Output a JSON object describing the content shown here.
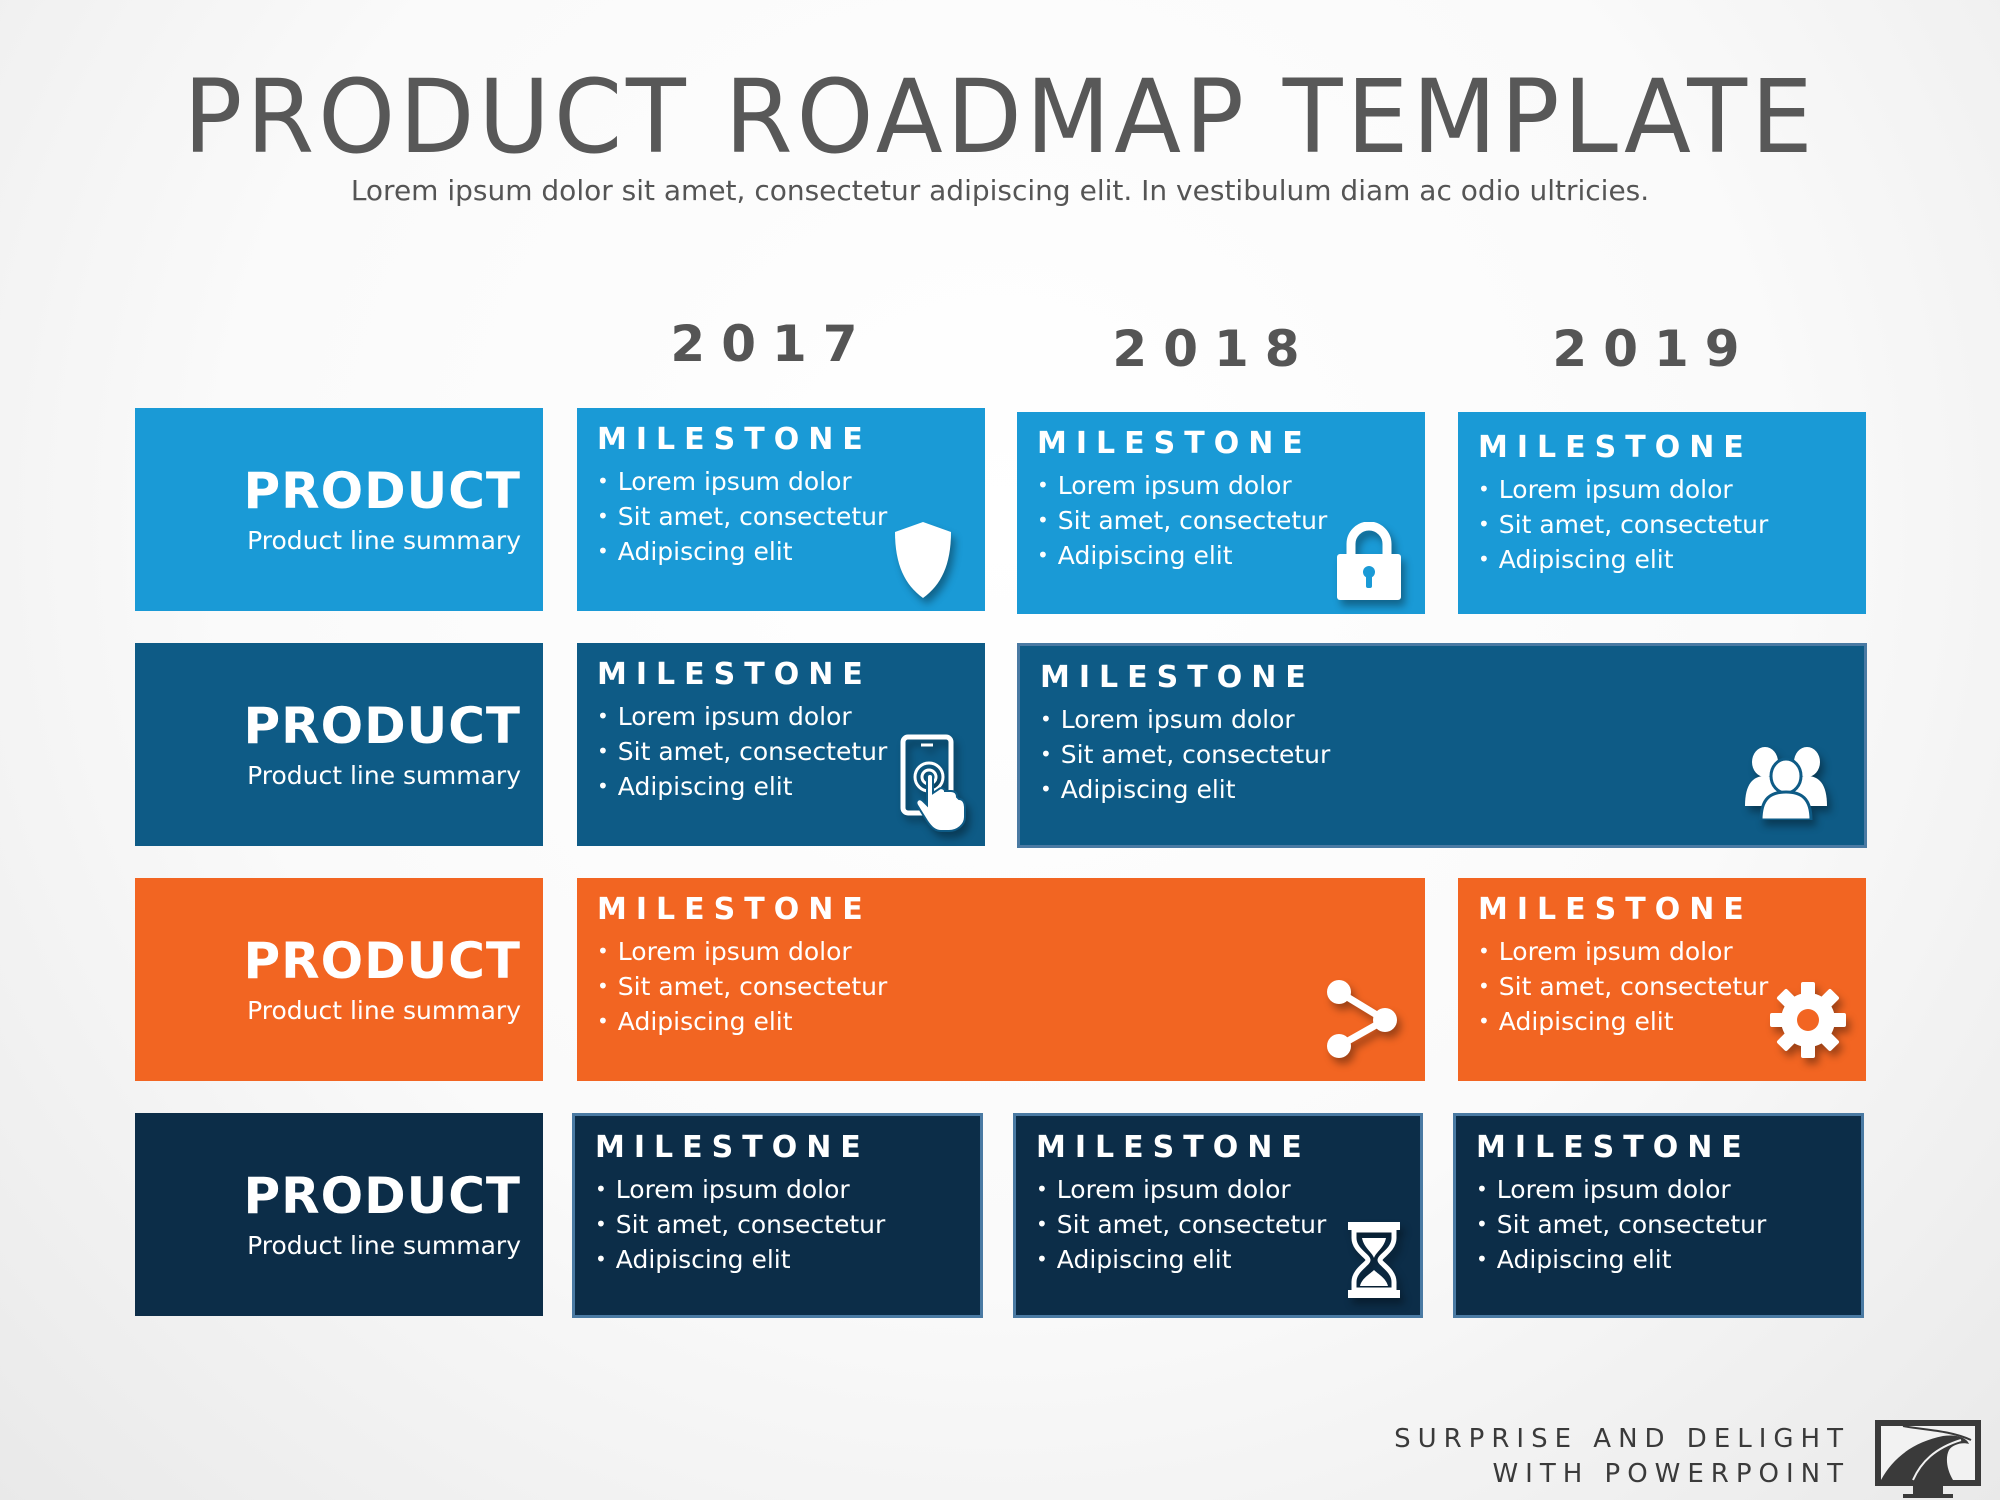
{
  "header": {
    "title": "PRODUCT ROADMAP TEMPLATE",
    "subtitle": "Lorem ipsum dolor sit amet, consectetur adipiscing elit. In vestibulum diam ac odio ultricies."
  },
  "years": [
    "2017",
    "2018",
    "2019"
  ],
  "colors": {
    "light_blue": "#1a9ad6",
    "medium_blue": "#0e5b86",
    "orange": "#f26522",
    "dark_navy": "#0c2d48",
    "text_gray": "#585858"
  },
  "rows": [
    {
      "product": "PRODUCT",
      "summary": "Product line summary",
      "milestones": [
        {
          "title": "MILESTONE",
          "span": "2017",
          "bullets": [
            "Lorem ipsum dolor",
            "Sit amet, consectetur",
            "Adipiscing elit"
          ],
          "icon": "shield-icon"
        },
        {
          "title": "MILESTONE",
          "span": "2018",
          "bullets": [
            "Lorem ipsum dolor",
            "Sit amet, consectetur",
            "Adipiscing elit"
          ],
          "icon": "lock-icon"
        },
        {
          "title": "MILESTONE",
          "span": "2019",
          "bullets": [
            "Lorem ipsum dolor",
            "Sit amet, consectetur",
            "Adipiscing elit"
          ],
          "icon": ""
        }
      ]
    },
    {
      "product": "PRODUCT",
      "summary": "Product line summary",
      "milestones": [
        {
          "title": "MILESTONE",
          "span": "2017",
          "bullets": [
            "Lorem ipsum dolor",
            "Sit amet, consectetur",
            "Adipiscing elit"
          ],
          "icon": "touch-phone-icon"
        },
        {
          "title": "MILESTONE",
          "span": "2018-2019",
          "bullets": [
            "Lorem ipsum dolor",
            "Sit amet, consectetur",
            "Adipiscing elit"
          ],
          "icon": "users-icon"
        }
      ]
    },
    {
      "product": "PRODUCT",
      "summary": "Product line summary",
      "milestones": [
        {
          "title": "MILESTONE",
          "span": "2017-2018",
          "bullets": [
            "Lorem ipsum dolor",
            "Sit amet, consectetur",
            "Adipiscing elit"
          ],
          "icon": "share-icon"
        },
        {
          "title": "MILESTONE",
          "span": "2019",
          "bullets": [
            "Lorem ipsum dolor",
            "Sit amet, consectetur",
            "Adipiscing elit"
          ],
          "icon": "gear-icon"
        }
      ]
    },
    {
      "product": "PRODUCT",
      "summary": "Product line summary",
      "milestones": [
        {
          "title": "MILESTONE",
          "span": "2017",
          "bullets": [
            "Lorem ipsum dolor",
            "Sit amet, consectetur",
            "Adipiscing elit"
          ],
          "icon": ""
        },
        {
          "title": "MILESTONE",
          "span": "2018",
          "bullets": [
            "Lorem ipsum dolor",
            "Sit amet, consectetur",
            "Adipiscing elit"
          ],
          "icon": "hourglass-icon"
        },
        {
          "title": "MILESTONE",
          "span": "2019",
          "bullets": [
            "Lorem ipsum dolor",
            "Sit amet, consectetur",
            "Adipiscing elit"
          ],
          "icon": ""
        }
      ]
    }
  ],
  "footer": {
    "line1": "SURPRISE AND DELIGHT",
    "line2": "WITH POWERPOINT",
    "logo_icon": "road-monitor-icon"
  }
}
